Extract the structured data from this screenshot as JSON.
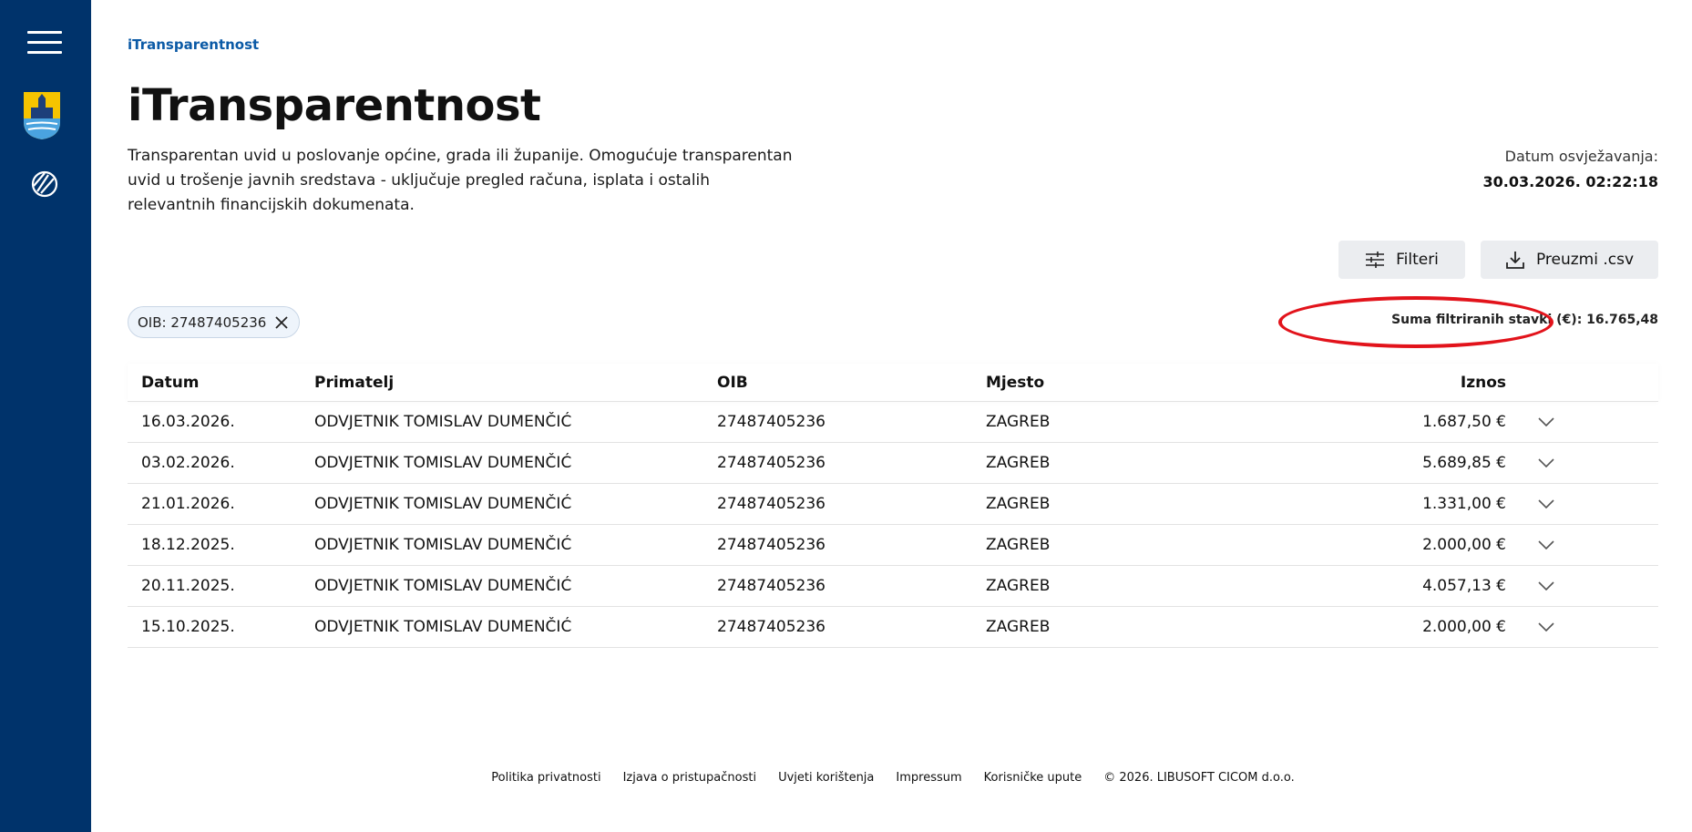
{
  "sidebar": {
    "menu_icon": "hamburger-menu-icon",
    "crest_icon": "coat-of-arms-icon",
    "app_icon": "itransparentnost-logo-icon",
    "colors": {
      "background": "#00336b"
    }
  },
  "breadcrumb": "iTransparentnost",
  "title": "iTransparentnost",
  "description": "Transparentan uvid u poslovanje općine, grada ili županije. Omogućuje transparentan uvid u trošenje javnih sredstava - uključuje pregled računa, isplata i ostalih relevantnih financijskih dokumenata.",
  "refresh": {
    "label": "Datum osvježavanja:",
    "value": "30.03.2026. 02:22:18"
  },
  "toolbar": {
    "filter_label": "Filteri",
    "filter_icon": "sliders-icon",
    "download_label": "Preuzmi .csv",
    "download_icon": "download-icon"
  },
  "active_filter": {
    "label": "OIB: 27487405236",
    "close_icon": "close-icon"
  },
  "sum": {
    "text": "Suma filtriranih stavki (€): 16.765,48",
    "highlight_color": "#e2131b"
  },
  "table": {
    "headers": {
      "date": "Datum",
      "recipient": "Primatelj",
      "oib": "OIB",
      "place": "Mjesto",
      "amount": "Iznos"
    },
    "rows": [
      {
        "date": "16.03.2026.",
        "recipient": "ODVJETNIK TOMISLAV DUMENČIĆ",
        "oib": "27487405236",
        "place": "ZAGREB",
        "amount": "1.687,50 €"
      },
      {
        "date": "03.02.2026.",
        "recipient": "ODVJETNIK TOMISLAV DUMENČIĆ",
        "oib": "27487405236",
        "place": "ZAGREB",
        "amount": "5.689,85 €"
      },
      {
        "date": "21.01.2026.",
        "recipient": "ODVJETNIK TOMISLAV DUMENČIĆ",
        "oib": "27487405236",
        "place": "ZAGREB",
        "amount": "1.331,00 €"
      },
      {
        "date": "18.12.2025.",
        "recipient": "ODVJETNIK TOMISLAV DUMENČIĆ",
        "oib": "27487405236",
        "place": "ZAGREB",
        "amount": "2.000,00 €"
      },
      {
        "date": "20.11.2025.",
        "recipient": "ODVJETNIK TOMISLAV DUMENČIĆ",
        "oib": "27487405236",
        "place": "ZAGREB",
        "amount": "4.057,13 €"
      },
      {
        "date": "15.10.2025.",
        "recipient": "ODVJETNIK TOMISLAV DUMENČIĆ",
        "oib": "27487405236",
        "place": "ZAGREB",
        "amount": "2.000,00 €"
      }
    ]
  },
  "footer": {
    "links": [
      "Politika privatnosti",
      "Izjava o pristupačnosti",
      "Uvjeti korištenja",
      "Impressum",
      "Korisničke upute"
    ],
    "copyright": "© 2026. LIBUSOFT CICOM d.o.o."
  }
}
